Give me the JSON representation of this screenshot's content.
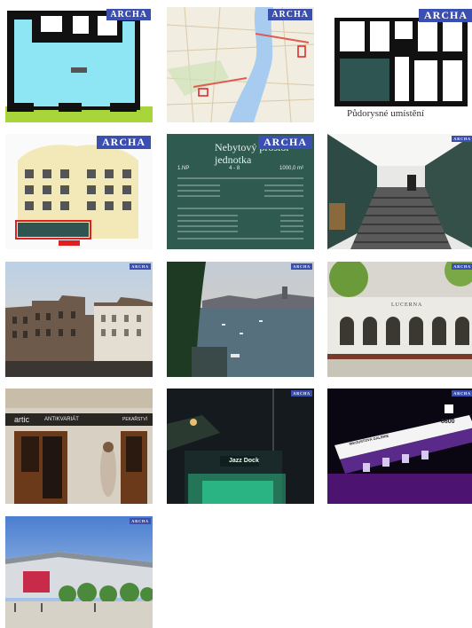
{
  "gallery": {
    "watermark": "ARCHA",
    "floorplan_caption": "Půdorysné umístění",
    "sheet": {
      "title": "Nebytový prostor",
      "subtitle": "jednotka",
      "stat1": "1.NP",
      "stat2": "4 - 8",
      "stat3": "1000,0 m²"
    },
    "shop_sign": "artic",
    "shop_sign_sub": "ANTIKVARIÁT",
    "shop_sign_right": "PEKAŘSTVÍ",
    "building_sign": "LUCERNA",
    "club_sign": "Jazz Dock",
    "theatre_sign": "INKOUSTOVÁ GALERIE",
    "theatre_number": "8600"
  },
  "colors": {
    "watermark_bg": "#3b4fb0",
    "plan_cyan": "#8ee6f5",
    "plan_teal": "#2f5552",
    "sheet_green": "#2f5a50",
    "river": "#a8cbf0"
  }
}
